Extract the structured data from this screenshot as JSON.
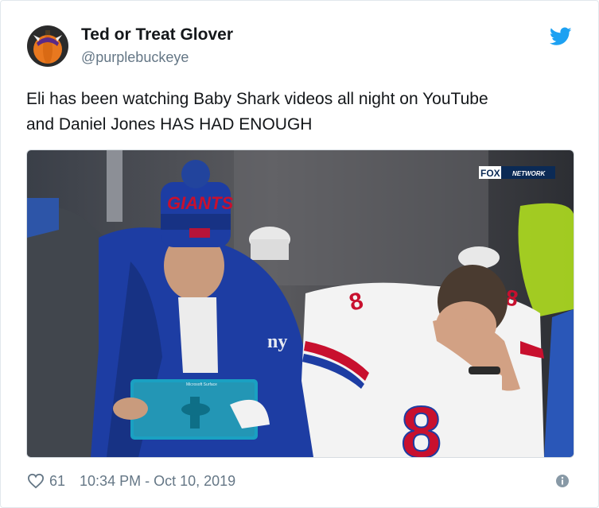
{
  "author": {
    "display_name": "Ted or Treat Glover",
    "handle": "@purplebuckeye"
  },
  "tweet": {
    "text_lines": [
      "Eli has been watching Baby Shark videos all night on YouTube",
      "and Daniel Jones HAS HAD ENOUGH"
    ]
  },
  "media": {
    "network_logo_fox": "FOX",
    "network_logo_network": "NETWORK",
    "beanie_text": "GIANTS",
    "jersey_number": "8",
    "tablet_label": "Microsoft Surface"
  },
  "footer": {
    "like_count": "61",
    "timestamp": "10:34 PM - Oct 10, 2019"
  },
  "icons": {
    "bird": "twitter-bird-icon",
    "like": "heart-icon",
    "info": "info-icon"
  },
  "colors": {
    "twitter_blue": "#1da1f2",
    "secondary_text": "#657786",
    "giants_blue": "#1b3ea8",
    "giants_red": "#c8102e"
  }
}
